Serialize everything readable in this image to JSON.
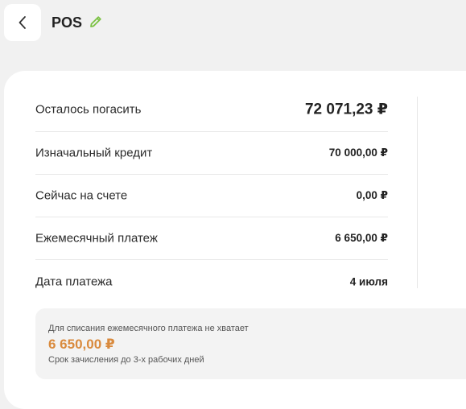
{
  "header": {
    "title": "POS",
    "back_icon": "chevron-left-icon",
    "edit_icon": "pencil-icon",
    "edit_color": "#7ac142"
  },
  "rows": [
    {
      "label": "Осталось погасить",
      "value": "72 071,23 ₽"
    },
    {
      "label": "Изначальный кредит",
      "value": "70 000,00 ₽"
    },
    {
      "label": "Сейчас на счете",
      "value": "0,00 ₽"
    },
    {
      "label": "Ежемесячный платеж",
      "value": "6 650,00 ₽"
    },
    {
      "label": "Дата платежа",
      "value": "4 июля"
    }
  ],
  "notice": {
    "text": "Для списания ежемесячного платежа не хватает",
    "amount": "6 650,00 ₽",
    "amount_color": "#d98a3d",
    "subtext": "Срок зачисления до 3-х рабочих дней"
  }
}
